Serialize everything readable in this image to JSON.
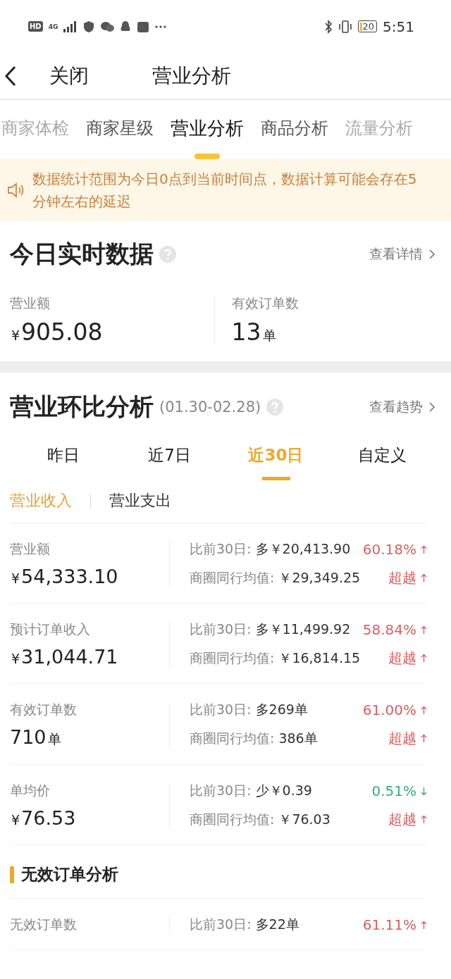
{
  "status_bar": {
    "hd": "HD",
    "time": "5:51",
    "battery": "20",
    "network": "4G"
  },
  "header": {
    "close": "关闭",
    "title": "营业分析"
  },
  "tabs": [
    {
      "label": "商家体检",
      "selected": false
    },
    {
      "label": "商家星级",
      "selected": false
    },
    {
      "label": "营业分析",
      "selected": true
    },
    {
      "label": "商品分析",
      "selected": false
    },
    {
      "label": "流量分析",
      "selected": false
    }
  ],
  "notice": "数据统计范围为今日0点到当前时间点，数据计算可能会存在5分钟左右的延迟",
  "realtime": {
    "title": "今日实时数据",
    "link": "查看详情",
    "metrics": [
      {
        "label": "营业额",
        "prefix": "¥",
        "amount": "905.08"
      },
      {
        "label": "有效订单数",
        "amount": "13",
        "unit": "单"
      }
    ]
  },
  "compare": {
    "title": "营业环比分析",
    "date_range": "(01.30-02.28)",
    "link": "查看趋势",
    "periods": [
      {
        "label": "昨日",
        "selected": false
      },
      {
        "label": "近7日",
        "selected": false
      },
      {
        "label": "近30日",
        "selected": true
      },
      {
        "label": "自定义",
        "selected": false
      }
    ],
    "subtabs": [
      {
        "label": "营业收入",
        "selected": true
      },
      {
        "label": "营业支出",
        "selected": false
      }
    ],
    "rows": [
      {
        "label": "营业额",
        "prefix": "¥",
        "amount": "54,333.10",
        "comparisons": [
          {
            "label": "比前30日:",
            "value": "多￥20,413.90",
            "change": "60.18%",
            "rising": true
          },
          {
            "label": "商圈同行均值:",
            "value": "￥29,349.25",
            "change": "超越",
            "rising": true
          }
        ]
      },
      {
        "label": "预计订单收入",
        "prefix": "¥",
        "amount": "31,044.71",
        "comparisons": [
          {
            "label": "比前30日:",
            "value": "多￥11,499.92",
            "change": "58.84%",
            "rising": true
          },
          {
            "label": "商圈同行均值:",
            "value": "￥16,814.15",
            "change": "超越",
            "rising": true
          }
        ]
      },
      {
        "label": "有效订单数",
        "amount": "710",
        "unit": "单",
        "comparisons": [
          {
            "label": "比前30日:",
            "value": "多269单",
            "change": "61.00%",
            "rising": true
          },
          {
            "label": "商圈同行均值:",
            "value": "386单",
            "change": "超越",
            "rising": true
          }
        ]
      },
      {
        "label": "单均价",
        "prefix": "¥",
        "amount": "76.53",
        "comparisons": [
          {
            "label": "比前30日:",
            "value": "少￥0.39",
            "change": "0.51%",
            "rising": false
          },
          {
            "label": "商圈同行均值:",
            "value": "￥76.03",
            "change": "超越",
            "rising": true
          }
        ]
      }
    ]
  },
  "invalid": {
    "title": "无效订单分析",
    "rows": [
      {
        "label": "无效订单数",
        "comparisons": [
          {
            "label": "比前30日:",
            "value": "多22单",
            "change": "61.11%",
            "rising": true
          }
        ]
      }
    ]
  }
}
